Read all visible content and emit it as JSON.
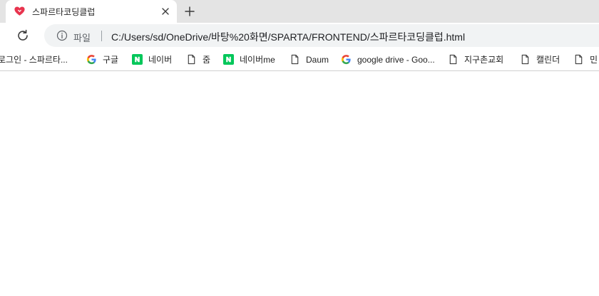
{
  "tab": {
    "title": "스파르타코딩클럽",
    "favicon": "sparta-heart-icon",
    "favicon_color": "#e8344e"
  },
  "toolbar": {
    "scheme_label": "파일",
    "url": "C:/Users/sd/OneDrive/바탕%20화면/SPARTA/FRONTEND/스파르타코딩클럽.html"
  },
  "bookmarks": [
    {
      "label": "로그인 - 스파르타...",
      "icon": "none"
    },
    {
      "label": "구글",
      "icon": "google-icon"
    },
    {
      "label": "네이버",
      "icon": "naver-icon"
    },
    {
      "label": "줌",
      "icon": "page-icon"
    },
    {
      "label": "네이버me",
      "icon": "naver-icon"
    },
    {
      "label": "Daum",
      "icon": "page-icon"
    },
    {
      "label": "google drive - Goo...",
      "icon": "google-icon"
    },
    {
      "label": "지구촌교회",
      "icon": "page-icon"
    },
    {
      "label": "캘린더",
      "icon": "page-icon"
    },
    {
      "label": "민",
      "icon": "page-icon"
    }
  ],
  "colors": {
    "tabstrip": "#e4e4e4",
    "omnibox": "#f1f3f4",
    "naver_green": "#03c75a"
  }
}
